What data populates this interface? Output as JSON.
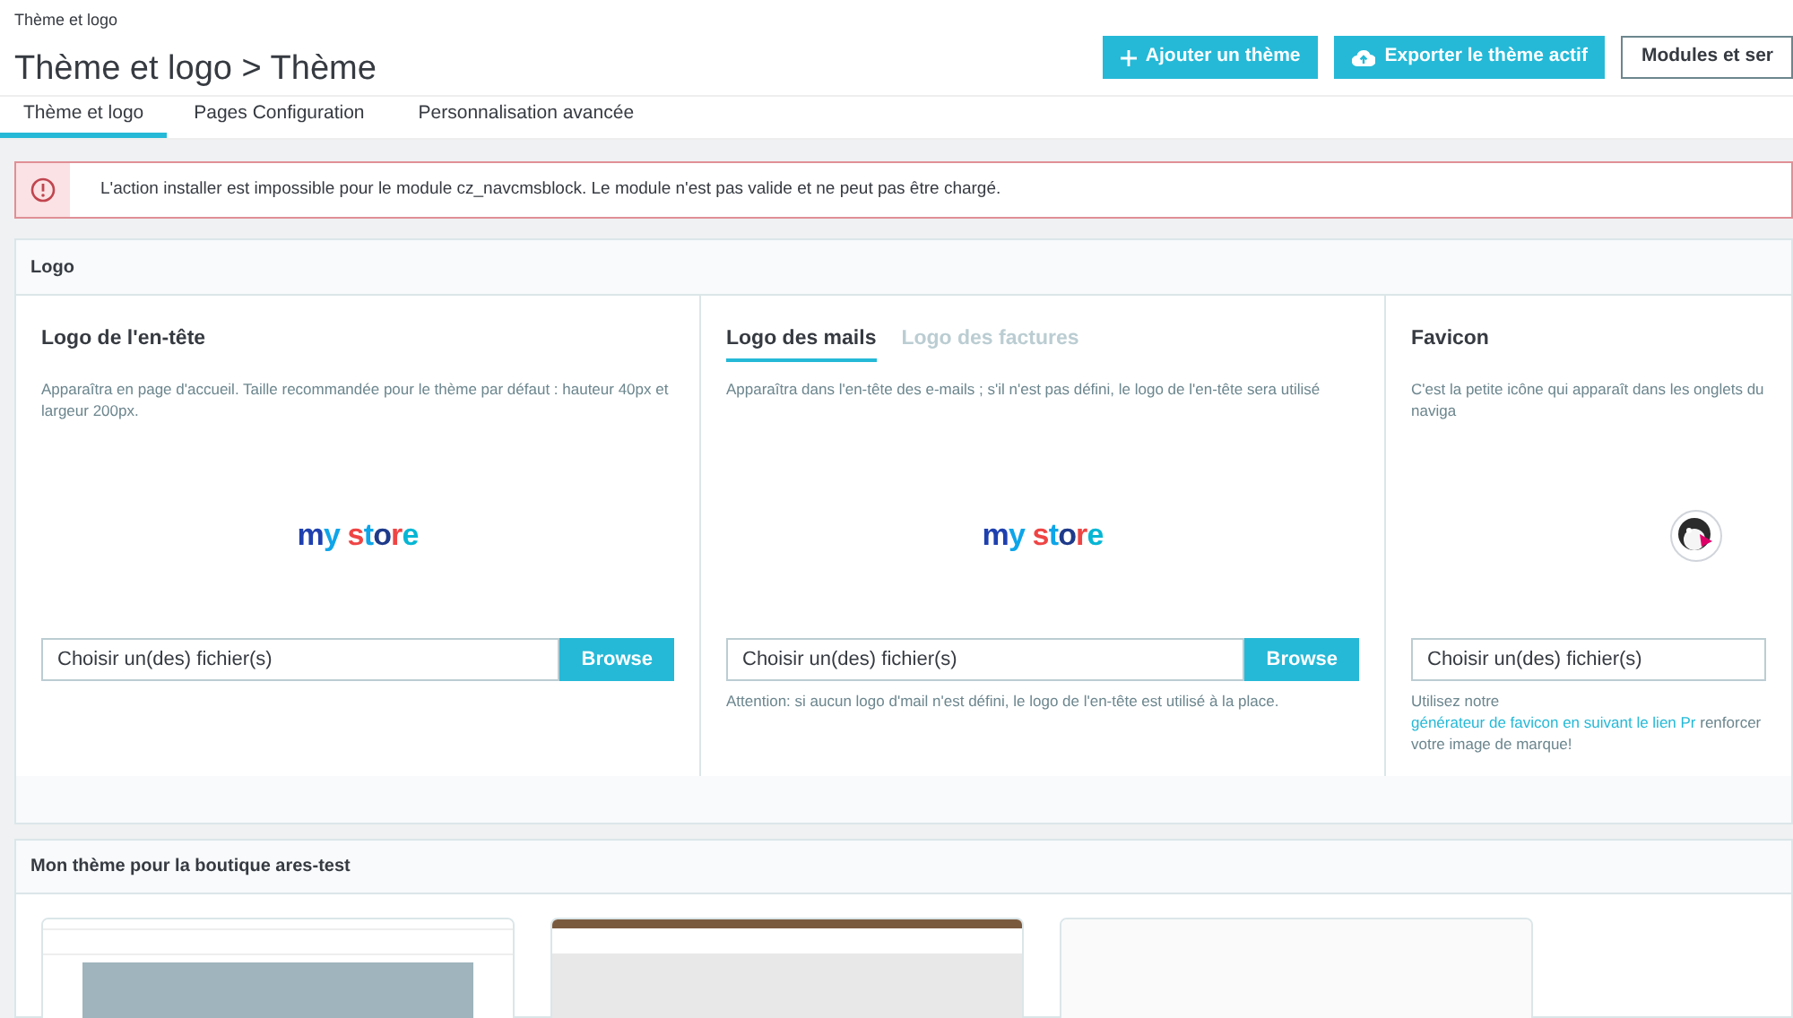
{
  "header": {
    "breadcrumb": "Thème et logo",
    "title": "Thème et logo > Thème",
    "buttons": [
      {
        "kind": "add",
        "label": "Ajouter un thème"
      },
      {
        "kind": "export",
        "label": "Exporter le thème actif"
      },
      {
        "kind": "outline",
        "label": "Modules et ser"
      }
    ]
  },
  "tabs": [
    {
      "label": "Thème et logo",
      "selected": true
    },
    {
      "label": "Pages Configuration",
      "selected": false
    },
    {
      "label": "Personnalisation avancée",
      "selected": false
    }
  ],
  "alert": {
    "message": "L'action installer est impossible pour le module cz_navcmsblock. Le module n'est pas valide et ne peut pas être chargé."
  },
  "logo_panel": {
    "title": "Logo",
    "columns": [
      {
        "kind": "upload",
        "title": "Logo de l'en-tête",
        "description": "Apparaîtra en page d'accueil. Taille recommandée pour le thème par défaut : hauteur 40px et largeur 200px.",
        "logo": "my store",
        "placeholder": "Choisir un(des) fichier(s)",
        "browse": "Browse"
      },
      {
        "kind": "tabbed",
        "tabs": [
          {
            "label": "Logo des mails",
            "selected": true
          },
          {
            "label": "Logo des factures",
            "selected": false
          }
        ],
        "description": "Apparaîtra dans l'en-tête des e-mails ; s'il n'est pas défini, le logo de l'en-tête sera utilisé",
        "logo": "my store",
        "placeholder": "Choisir un(des) fichier(s)",
        "browse": "Browse",
        "note": "Attention: si aucun logo d'mail n'est défini, le logo de l'en-tête est utilisé à la place."
      },
      {
        "kind": "favicon",
        "title": "Favicon",
        "description": "C'est la petite icône qui apparaît dans les onglets du naviga",
        "placeholder": "Choisir un(des) fichier(s)",
        "help_prefix": "Utilisez notre ",
        "help_link": "générateur de favicon en suivant le lien Pr",
        "help_suffix": " renforcer votre image de marque!"
      }
    ]
  },
  "themes_panel": {
    "title": "Mon thème pour la boutique ares-test",
    "themes": [
      {
        "kind": "light"
      },
      {
        "kind": "banner"
      },
      {
        "kind": "blank"
      }
    ]
  }
}
